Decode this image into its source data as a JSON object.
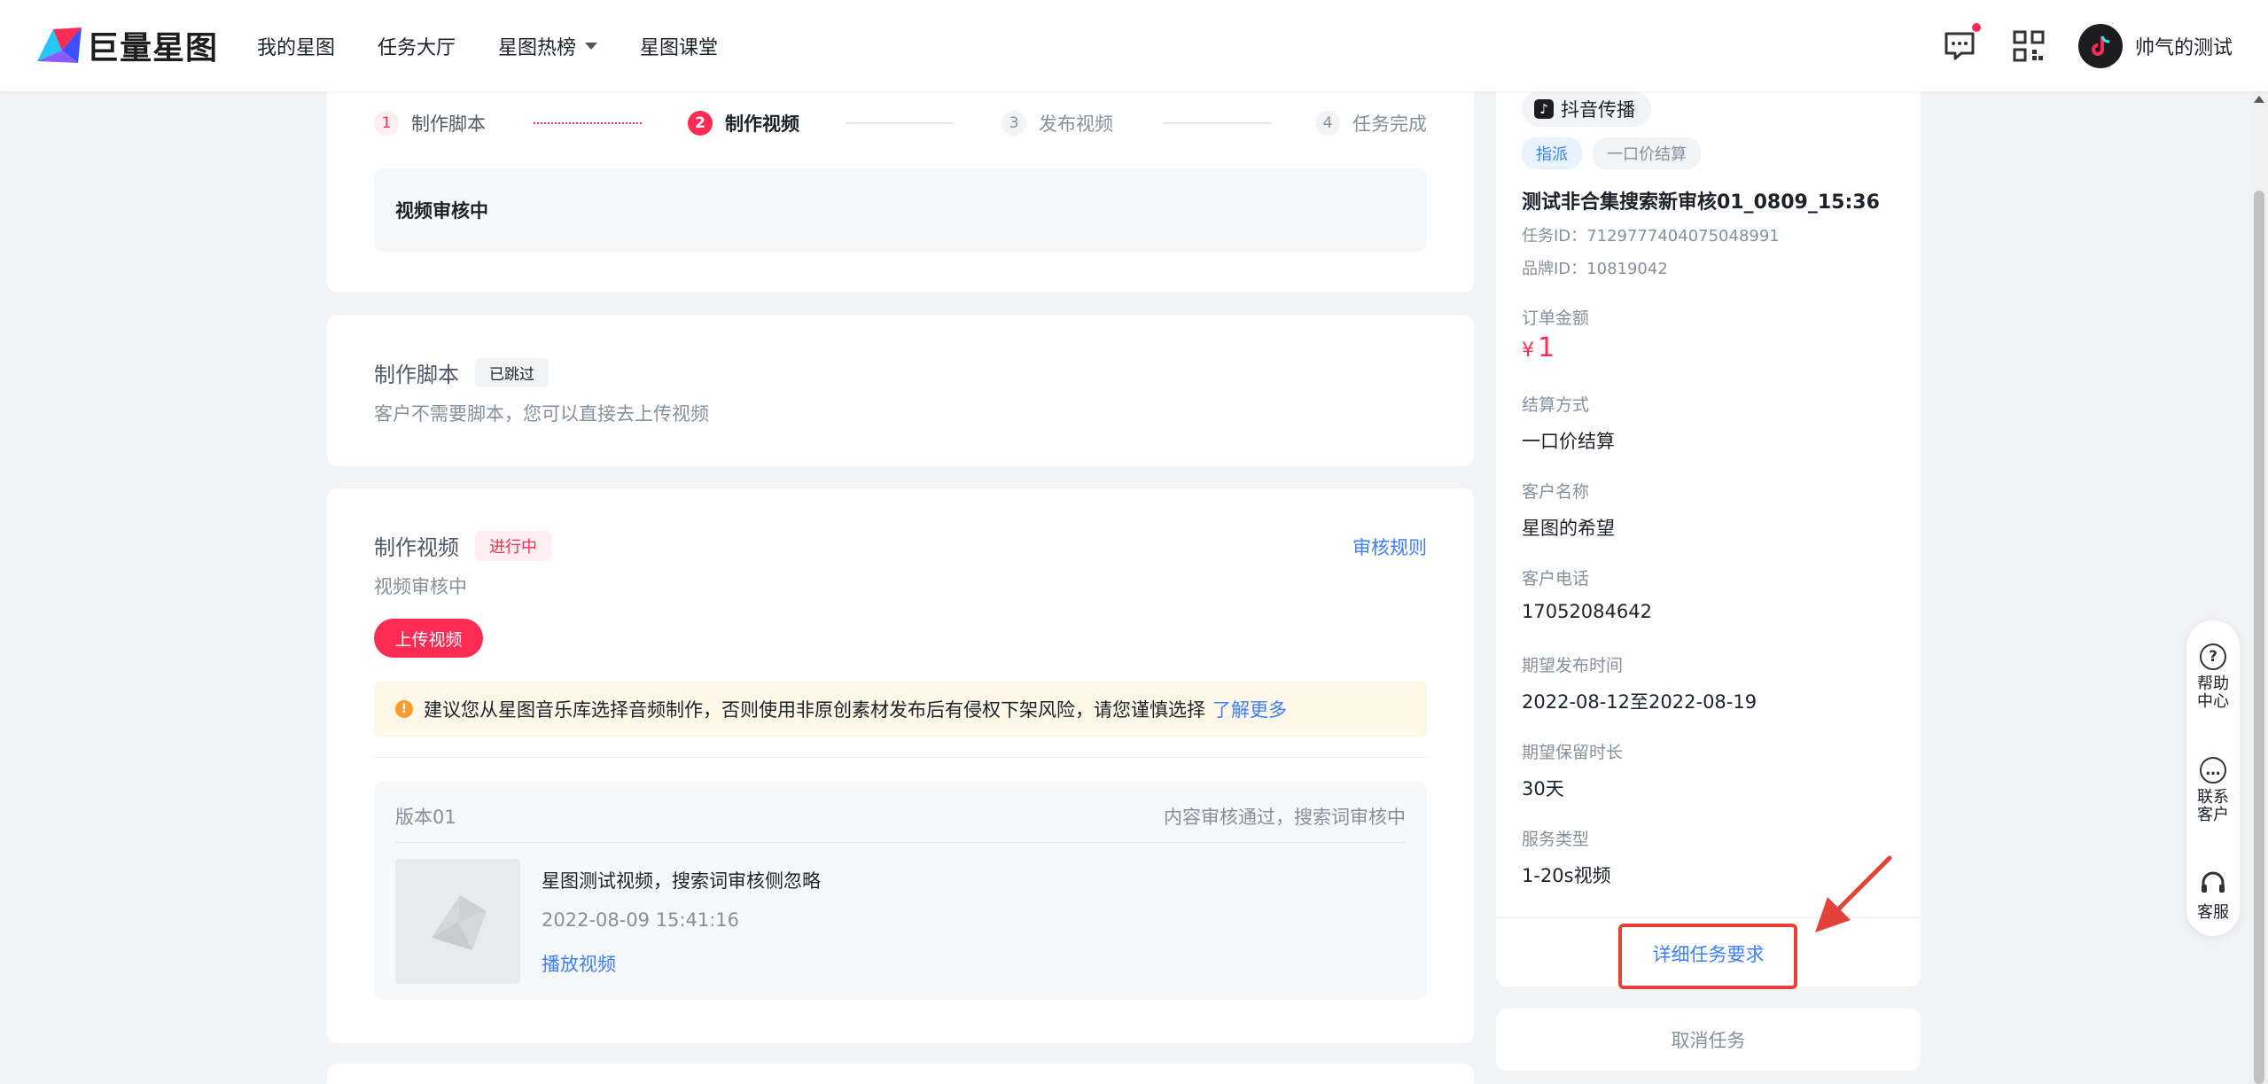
{
  "header": {
    "brand": "巨量星图",
    "nav": [
      "我的星图",
      "任务大厅",
      "星图热榜",
      "星图课堂"
    ],
    "username": "帅气的测试"
  },
  "steps": [
    {
      "num": "1",
      "label": "制作脚本"
    },
    {
      "num": "2",
      "label": "制作视频"
    },
    {
      "num": "3",
      "label": "发布视频"
    },
    {
      "num": "4",
      "label": "任务完成"
    }
  ],
  "status_box": "视频审核中",
  "script_section": {
    "title": "制作脚本",
    "tag": "已跳过",
    "desc": "客户不需要脚本，您可以直接去上传视频"
  },
  "video_section": {
    "title": "制作视频",
    "tag": "进行中",
    "audit_rule": "审核规则",
    "status": "视频审核中",
    "upload_button": "上传视频",
    "warning": "建议您从星图音乐库选择音频制作，否则使用非原创素材发布后有侵权下架风险，请您谨慎选择",
    "learn_more": "了解更多",
    "version": {
      "label": "版本01",
      "status": "内容审核通过，搜索词审核中",
      "title": "星图测试视频，搜索词审核侧忽略",
      "time": "2022-08-09 15:41:16",
      "play": "播放视频"
    }
  },
  "task_info": {
    "platform": "抖音传播",
    "tags": [
      "指派",
      "一口价结算"
    ],
    "title": "测试非合集搜索新审核01_0809_15:36",
    "task_id": "任务ID：7129777404075048991",
    "brand_id": "品牌ID：10819042",
    "fields": [
      {
        "label": "订单金额",
        "value": ""
      },
      {
        "label": "结算方式",
        "value": "一口价结算"
      },
      {
        "label": "客户名称",
        "value": "星图的希望"
      },
      {
        "label": "客户电话",
        "value": "17052084642"
      },
      {
        "label": "期望发布时间",
        "value": "2022-08-12至2022-08-19"
      },
      {
        "label": "期望保留时长",
        "value": "30天"
      },
      {
        "label": "服务类型",
        "value": "1-20s视频"
      }
    ],
    "price_symbol": "¥",
    "price_value": "1",
    "detail_link": "详细任务要求",
    "cancel": "取消任务"
  },
  "side_tools": [
    {
      "icon": "?",
      "label1": "帮助",
      "label2": "中心"
    },
    {
      "icon": "…",
      "label1": "联系",
      "label2": "客户"
    },
    {
      "icon": "",
      "label1": "客服",
      "label2": ""
    }
  ],
  "colors": {
    "accent": "#fe2c55",
    "link": "#3d7fff",
    "annotation": "#e5413b"
  }
}
